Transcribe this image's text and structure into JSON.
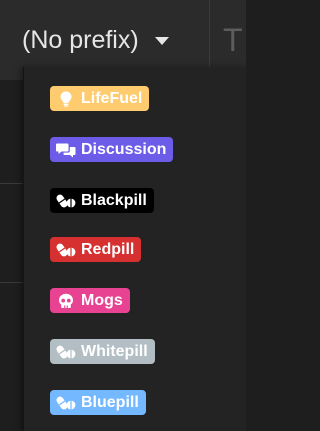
{
  "header": {
    "prefix_select_label": "(No prefix)",
    "title_partial": "T"
  },
  "prefix_menu": {
    "items": [
      {
        "label": "LifeFuel",
        "icon": "lightbulb-icon",
        "bg": "#fecb6e"
      },
      {
        "label": "Discussion",
        "icon": "comments-icon",
        "bg": "#6c5ce7"
      },
      {
        "label": "Blackpill",
        "icon": "pills-icon",
        "bg": "#000000"
      },
      {
        "label": "Redpill",
        "icon": "pills-icon",
        "bg": "#d63031"
      },
      {
        "label": "Mogs",
        "icon": "skull-icon",
        "bg": "#e84393"
      },
      {
        "label": "Whitepill",
        "icon": "pills-icon",
        "bg": "#b2bec3"
      },
      {
        "label": "Bluepill",
        "icon": "pills-icon",
        "bg": "#74b9ff"
      }
    ]
  }
}
